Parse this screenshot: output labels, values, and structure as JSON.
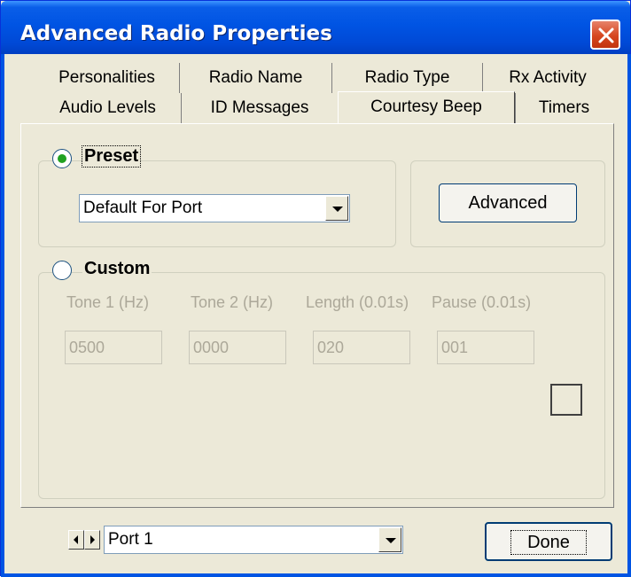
{
  "window": {
    "title": "Advanced Radio Properties"
  },
  "tabs_back": [
    "Personalities",
    "Radio Name",
    "Radio Type",
    "Rx Activity"
  ],
  "tabs_front": [
    "Audio Levels",
    "ID Messages",
    "Courtesy Beep",
    "Timers"
  ],
  "active_tab": "Courtesy Beep",
  "preset": {
    "label": "Preset",
    "selected": true,
    "dropdown_value": "Default For Port",
    "advanced_button": "Advanced"
  },
  "custom": {
    "label": "Custom",
    "selected": false,
    "fields": [
      {
        "label": "Tone 1 (Hz)",
        "value": "0500"
      },
      {
        "label": "Tone 2 (Hz)",
        "value": "0000"
      },
      {
        "label": "Length (0.01s)",
        "value": "020"
      },
      {
        "label": "Pause (0.01s)",
        "value": "001"
      }
    ]
  },
  "footer": {
    "port_value": "Port 1",
    "done_button": "Done"
  },
  "colors": {
    "titlebar": "#0054e3",
    "face": "#ece9d8",
    "close": "#d6461f",
    "disabled_text": "#aca899"
  }
}
